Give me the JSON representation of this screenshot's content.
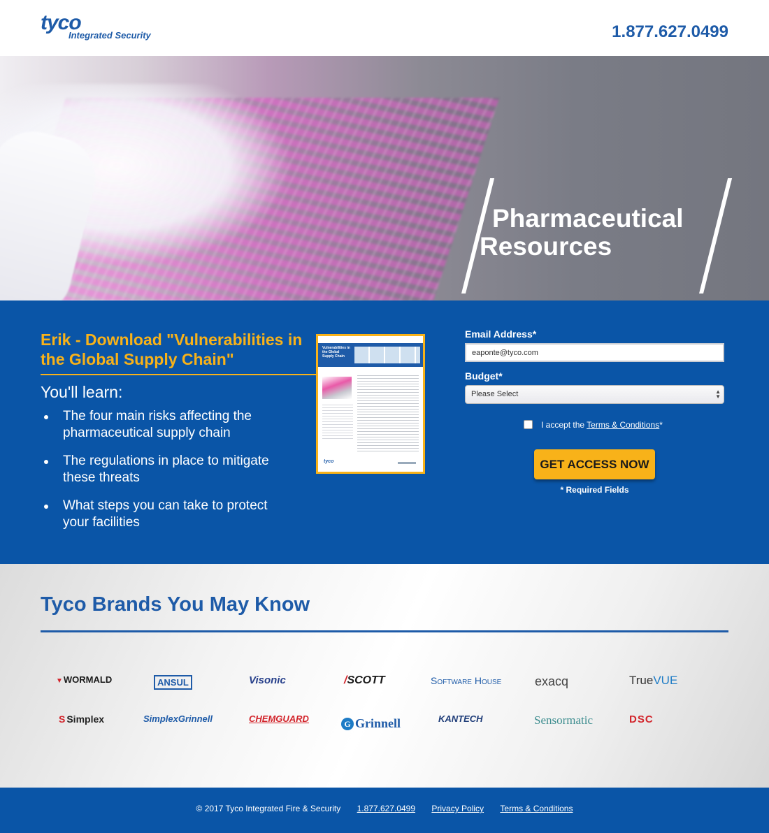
{
  "header": {
    "logo_main": "tyco",
    "logo_sub": "Integrated Security",
    "phone": "1.877.627.0499"
  },
  "hero": {
    "title_line1": "Pharmaceutical",
    "title_line2": "Resources"
  },
  "offer": {
    "title": "Erik - Download \"Vulnerabilities in the Global Supply Chain\"",
    "learn_heading": "You'll learn:",
    "learn_items": [
      "The four main risks affecting the pharmaceutical supply chain",
      "The regulations in place to mitigate these threats",
      "What steps you can take to protect your facilities"
    ],
    "doc_title": "Vulnerabilities in the Global Supply Chain",
    "doc_logo": "tyco"
  },
  "form": {
    "email_label": "Email Address*",
    "email_value": "eaponte@tyco.com",
    "budget_label": "Budget*",
    "budget_value": "Please Select",
    "terms_prefix": "I accept the ",
    "terms_link": "Terms & Conditions",
    "terms_suffix": "*",
    "cta_label": "GET ACCESS NOW",
    "required_note": "* Required Fields"
  },
  "brands": {
    "title": "Tyco Brands You May Know",
    "items": [
      "WORMALD",
      "ANSUL",
      "Visonic",
      "SCOTT",
      "Software House",
      "exacq",
      "True",
      "VUE",
      "Simplex",
      "SimplexGrinnell",
      "CHEMGUARD",
      "Grinnell",
      "KANTECH",
      "Sensormatic",
      "DSC"
    ]
  },
  "footer": {
    "copyright": "© 2017 Tyco Integrated Fire & Security",
    "phone": "1.877.627.0499",
    "privacy": "Privacy Policy",
    "terms": "Terms & Conditions"
  },
  "colors": {
    "brand_blue": "#1e5ba8",
    "section_blue": "#0a55a7",
    "accent_orange": "#f8b219"
  }
}
